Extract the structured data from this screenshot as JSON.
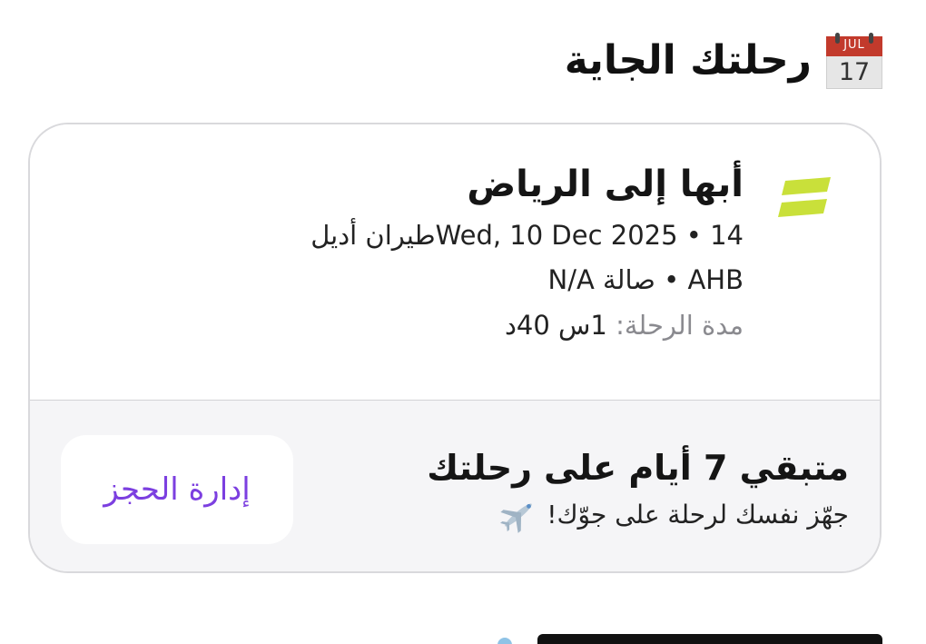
{
  "header": {
    "title": "رحلتك الجاية",
    "calendar_icon": "calendar-icon",
    "calendar_month": "JUL",
    "calendar_day": "17"
  },
  "flight_card": {
    "route": "أبها إلى الرياض",
    "airline_logo_icon": "airline-logo",
    "line1": "14 • Wed, 10 Dec 2025طيران أديل",
    "line2": "AHB • صالة N/A",
    "duration_label": "مدة الرحلة:",
    "duration_value": "1س 40د",
    "countdown_title": "متبقي 7 أيام على رحلتك",
    "countdown_subtitle": "جهّز نفسك لرحلة على جوّك!",
    "plane_icon": "airplane-icon",
    "manage_button_label": "إدارة الحجز",
    "colors": {
      "accent": "#7c3fe0",
      "logo": "#c9e03a",
      "card_border": "#d9d9dc",
      "bottom_bg": "#f5f5f7"
    }
  }
}
